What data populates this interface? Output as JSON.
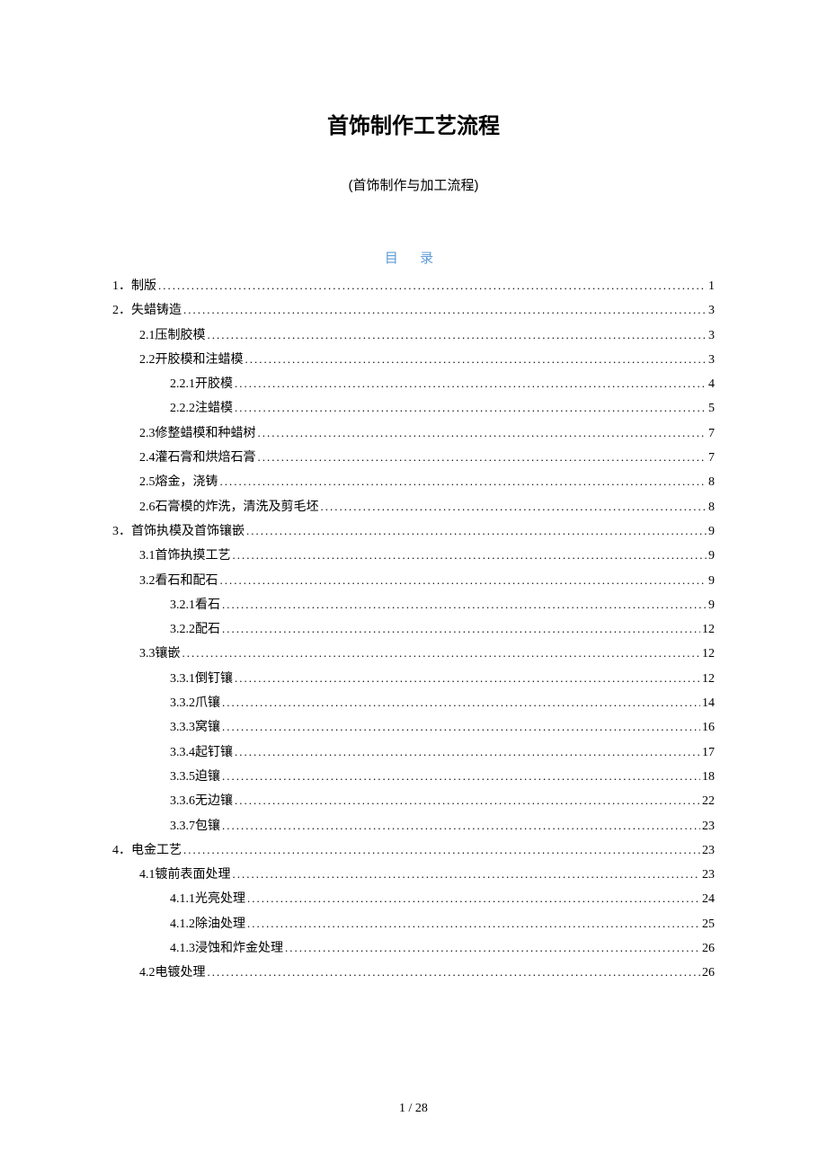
{
  "title": "首饰制作工艺流程",
  "subtitle": "(首饰制作与加工流程)",
  "toc_label": "目  录",
  "toc": [
    {
      "level": 0,
      "num": "1．",
      "text": "制版",
      "page": "1"
    },
    {
      "level": 0,
      "num": "2．",
      "text": "失蜡铸造",
      "page": "3"
    },
    {
      "level": 1,
      "num": "2.1 ",
      "text": "压制胶模",
      "page": "3"
    },
    {
      "level": 1,
      "num": "2.2 ",
      "text": "开胶模和注蜡模",
      "page": "3"
    },
    {
      "level": 2,
      "num": "2.2.1 ",
      "text": "开胶模",
      "page": "4"
    },
    {
      "level": 2,
      "num": "2.2.2 ",
      "text": "注蜡模",
      "page": "5"
    },
    {
      "level": 1,
      "num": "2.3 ",
      "text": "修整蜡模和种蜡树",
      "page": "7"
    },
    {
      "level": 1,
      "num": "2.4 ",
      "text": "灌石膏和烘焙石膏",
      "page": "7"
    },
    {
      "level": 1,
      "num": "2.5 ",
      "text": "熔金，浇铸",
      "page": "8"
    },
    {
      "level": 1,
      "num": "2.6 ",
      "text": "石膏模的炸洗，清洗及剪毛坯",
      "page": "8"
    },
    {
      "level": 0,
      "num": "3．",
      "text": "首饰执模及首饰镶嵌",
      "page": "9"
    },
    {
      "level": 1,
      "num": "3.1 ",
      "text": "首饰执摸工艺",
      "page": "9"
    },
    {
      "level": 1,
      "num": "3.2  ",
      "text": "看石和配石",
      "page": "9"
    },
    {
      "level": 2,
      "num": "3.2.1 ",
      "text": "看石",
      "page": "9"
    },
    {
      "level": 2,
      "num": "3.2.2 ",
      "text": "配石",
      "page": "12"
    },
    {
      "level": 1,
      "num": "3.3 ",
      "text": "镶嵌",
      "page": "12"
    },
    {
      "level": 2,
      "num": "3.3.1 ",
      "text": "倒钉镶",
      "page": "12"
    },
    {
      "level": 2,
      "num": "3.3.2 ",
      "text": "爪镶",
      "page": "14"
    },
    {
      "level": 2,
      "num": "3.3.3 ",
      "text": "窝镶",
      "page": "16"
    },
    {
      "level": 2,
      "num": "3.3.4 ",
      "text": "起钉镶",
      "page": "17"
    },
    {
      "level": 2,
      "num": "3.3.5 ",
      "text": "迫镶",
      "page": "18"
    },
    {
      "level": 2,
      "num": "3.3.6 ",
      "text": "无边镶",
      "page": "22"
    },
    {
      "level": 2,
      "num": "3.3.7 ",
      "text": "包镶",
      "page": "23"
    },
    {
      "level": 0,
      "num": "4．",
      "text": "电金工艺",
      "page": "23"
    },
    {
      "level": 1,
      "num": "4.1 ",
      "text": "镀前表面处理",
      "page": "23"
    },
    {
      "level": 2,
      "num": "4.1.1 ",
      "text": "光亮处理",
      "page": "24"
    },
    {
      "level": 2,
      "num": "4.1.2 ",
      "text": "除油处理",
      "page": "25"
    },
    {
      "level": 2,
      "num": "4.1.3 ",
      "text": "浸蚀和炸金处理",
      "page": "26"
    },
    {
      "level": 1,
      "num": "4.2 ",
      "text": "电镀处理",
      "page": "26"
    }
  ],
  "page_number": "1 / 28"
}
